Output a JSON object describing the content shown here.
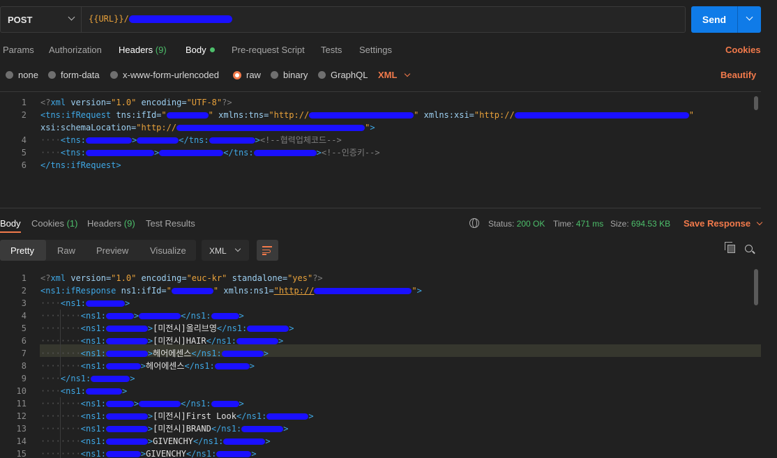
{
  "request": {
    "method": "POST",
    "url": "{{URL}}/",
    "send_label": "Send"
  },
  "req_tabs": {
    "params": "Params",
    "authorization": "Authorization",
    "headers": "Headers",
    "headers_count": "(9)",
    "body": "Body",
    "prerequest": "Pre-request Script",
    "tests": "Tests",
    "settings": "Settings",
    "cookies": "Cookies"
  },
  "body_types": {
    "none": "none",
    "form_data": "form-data",
    "urlencoded": "x-www-form-urlencoded",
    "raw": "raw",
    "binary": "binary",
    "graphql": "GraphQL",
    "format": "XML",
    "beautify": "Beautify"
  },
  "req_code": [
    {
      "n": "1",
      "t": "<?xml version=\"1.0\" encoding=\"UTF-8\"?>"
    },
    {
      "n": "2",
      "t": "<tns:ifRequest tns:ifId=\"\" xmlns:tns=\"http://\" xmlns:xsi=\"http://\""
    },
    {
      "n": "",
      "t": "xsi:schemaLocation=\"http://\">"
    },
    {
      "n": "4",
      "t": "<tns:></tns:><!--협력업체코드-->"
    },
    {
      "n": "5",
      "t": "<tns:></tns:><!--인증키-->"
    },
    {
      "n": "6",
      "t": "</tns:ifRequest>"
    }
  ],
  "resp_tabs": {
    "body": "Body",
    "cookies": "Cookies",
    "cookies_count": "(1)",
    "headers": "Headers",
    "headers_count": "(9)",
    "test_results": "Test Results"
  },
  "status": {
    "status_label": "Status:",
    "status_value": "200 OK",
    "time_label": "Time:",
    "time_value": "471 ms",
    "size_label": "Size:",
    "size_value": "694.53 KB",
    "save_response": "Save Response"
  },
  "view_modes": {
    "pretty": "Pretty",
    "raw": "Raw",
    "preview": "Preview",
    "visualize": "Visualize",
    "format": "XML"
  },
  "resp_code": [
    {
      "n": "1",
      "t": "<?xml version=\"1.0\" encoding=\"euc-kr\" standalone=\"yes\"?>"
    },
    {
      "n": "2",
      "t": "<ns1:ifResponse ns1:ifId=\"\" xmlns:ns1=\"http://\">"
    },
    {
      "n": "3",
      "t": "<ns1:>"
    },
    {
      "n": "4",
      "t": "<ns1:></ns1:>"
    },
    {
      "n": "5",
      "t": "<ns1:>[미전시]올리브영</ns1:>"
    },
    {
      "n": "6",
      "t": "<ns1:>[미전시]HAIR</ns1:>"
    },
    {
      "n": "7",
      "t": "<ns1:>헤어에센스</ns1:>"
    },
    {
      "n": "8",
      "t": "<ns1:>헤어에센스</ns1:>"
    },
    {
      "n": "9",
      "t": "</ns1:>"
    },
    {
      "n": "10",
      "t": "<ns1:>"
    },
    {
      "n": "11",
      "t": "<ns1:></ns1:>"
    },
    {
      "n": "12",
      "t": "<ns1:>[미전시]First Look</ns1:>"
    },
    {
      "n": "13",
      "t": "<ns1:>[미전시]BRAND</ns1:>"
    },
    {
      "n": "14",
      "t": "<ns1:>GIVENCHY</ns1:>"
    },
    {
      "n": "15",
      "t": "<ns1:>GIVENCHY</ns1:>"
    }
  ]
}
